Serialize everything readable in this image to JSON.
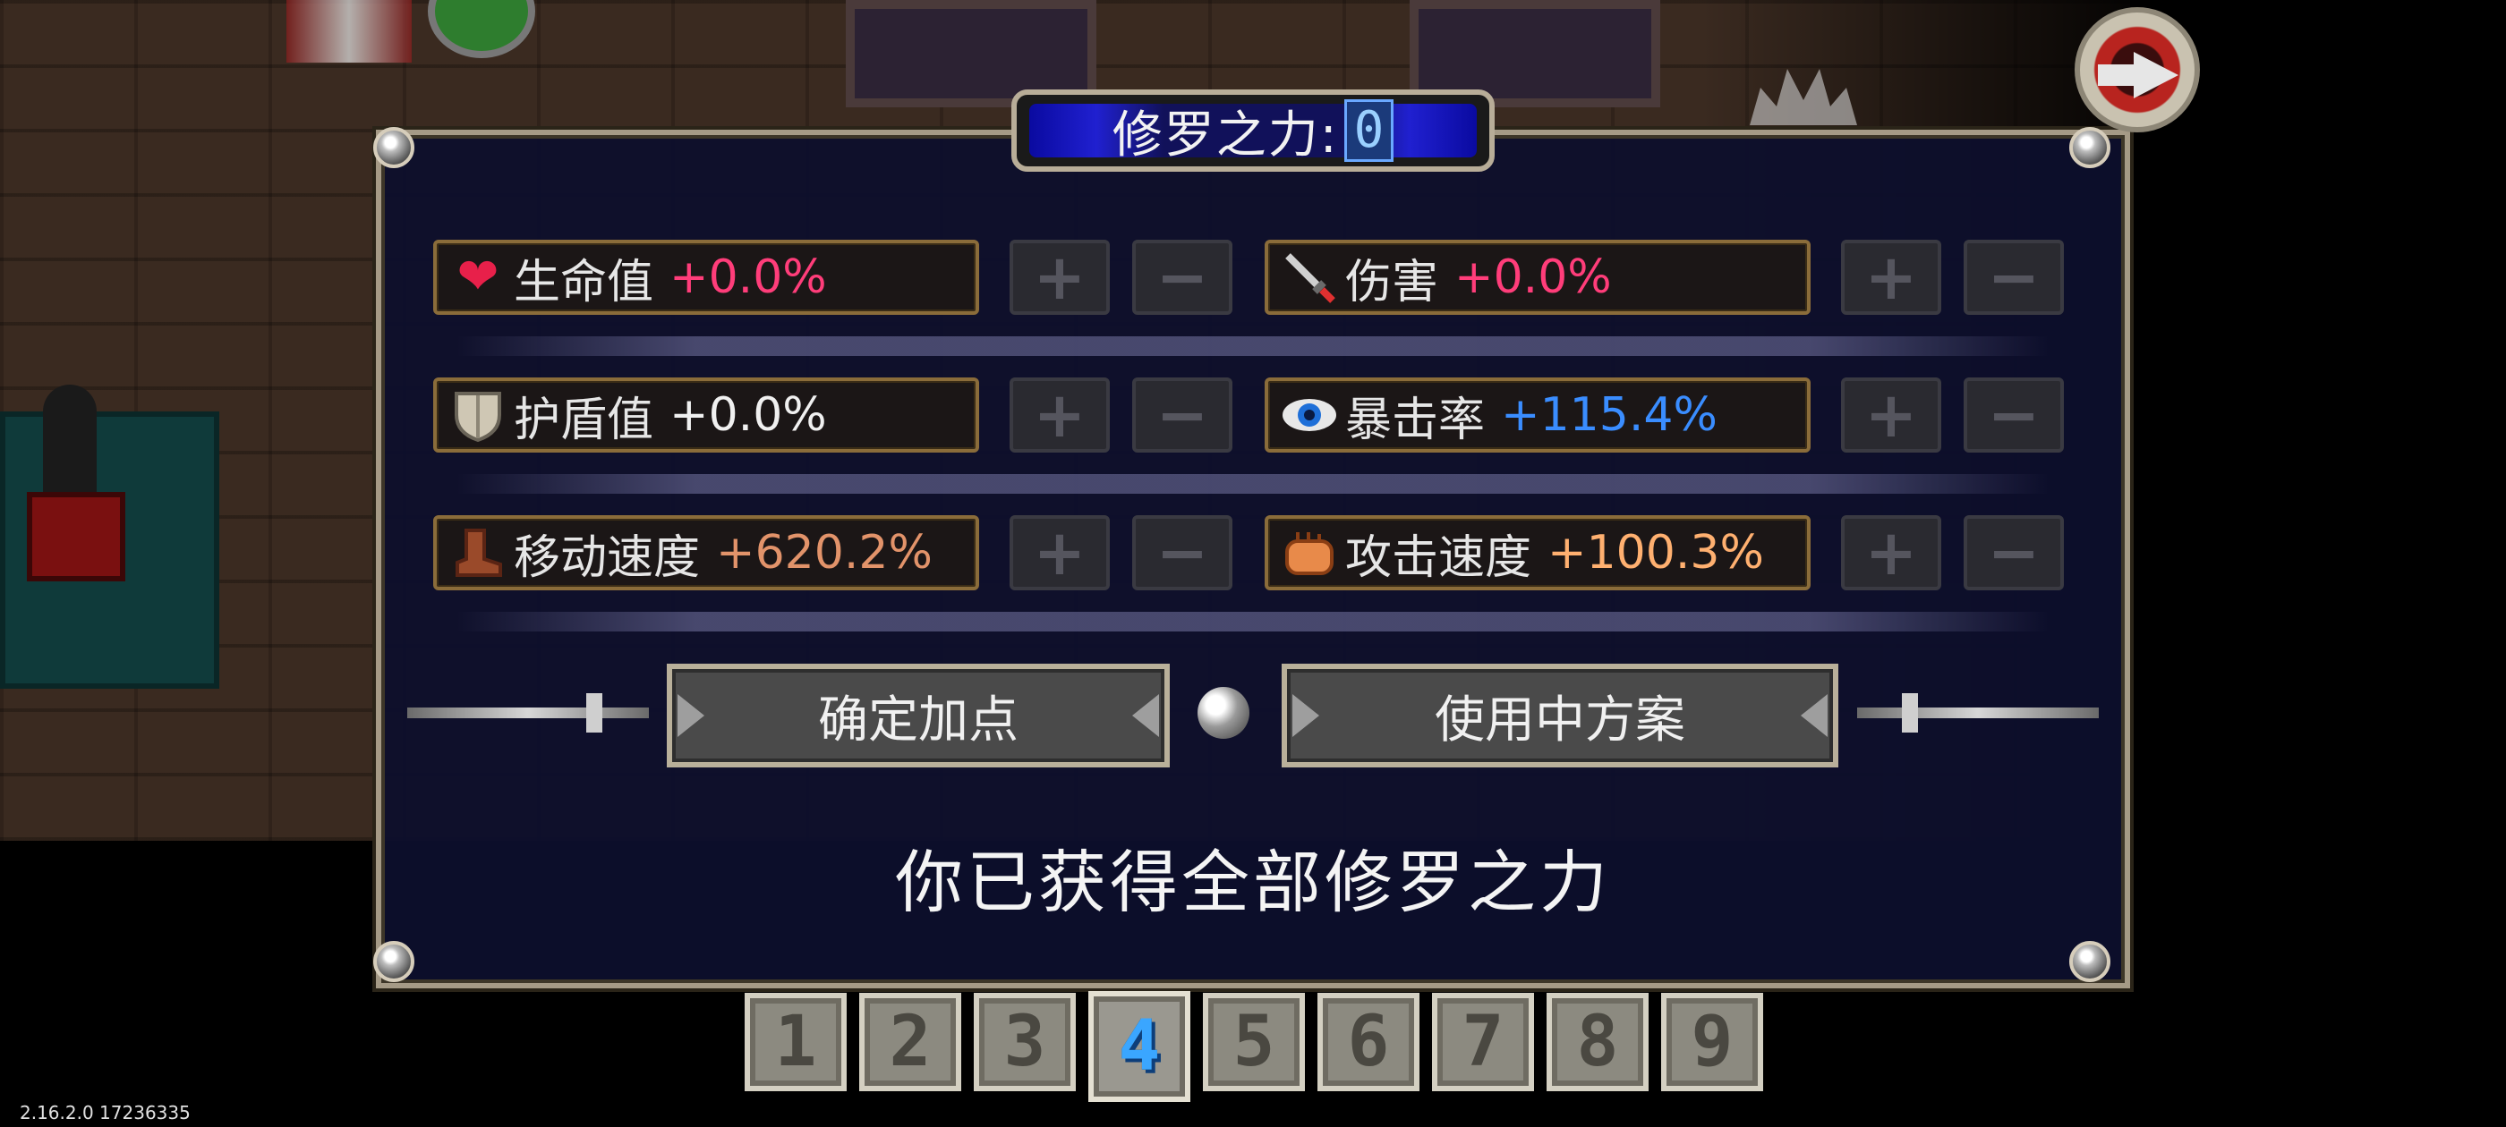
{
  "title": {
    "label": "修罗之力:",
    "value": "0"
  },
  "stats": [
    {
      "icon": "heart-icon",
      "label": "生命值",
      "value": "+0.0%",
      "color": "#ff3d7a"
    },
    {
      "icon": "sword-icon",
      "label": "伤害",
      "value": "+0.0%",
      "color": "#ff3d7a"
    },
    {
      "icon": "shield-icon",
      "label": "护盾值",
      "value": "+0.0%",
      "color": "#f0f0f0"
    },
    {
      "icon": "eye-icon",
      "label": "暴击率",
      "value": "+115.4%",
      "color": "#3a8dff"
    },
    {
      "icon": "boot-icon",
      "label": "移动速度",
      "value": "+620.2%",
      "color": "#e2936a"
    },
    {
      "icon": "fist-icon",
      "label": "攻击速度",
      "value": "+100.3%",
      "color": "#ffb070"
    }
  ],
  "controls": {
    "plus": "+",
    "minus": "−"
  },
  "actions": {
    "confirm": "确定加点",
    "in_use": "使用中方案"
  },
  "notice": "你已获得全部修罗之力",
  "slots": [
    "1",
    "2",
    "3",
    "4",
    "5",
    "6",
    "7",
    "8",
    "9"
  ],
  "active_slot": "4",
  "version": "2.16.2.0 17236335"
}
